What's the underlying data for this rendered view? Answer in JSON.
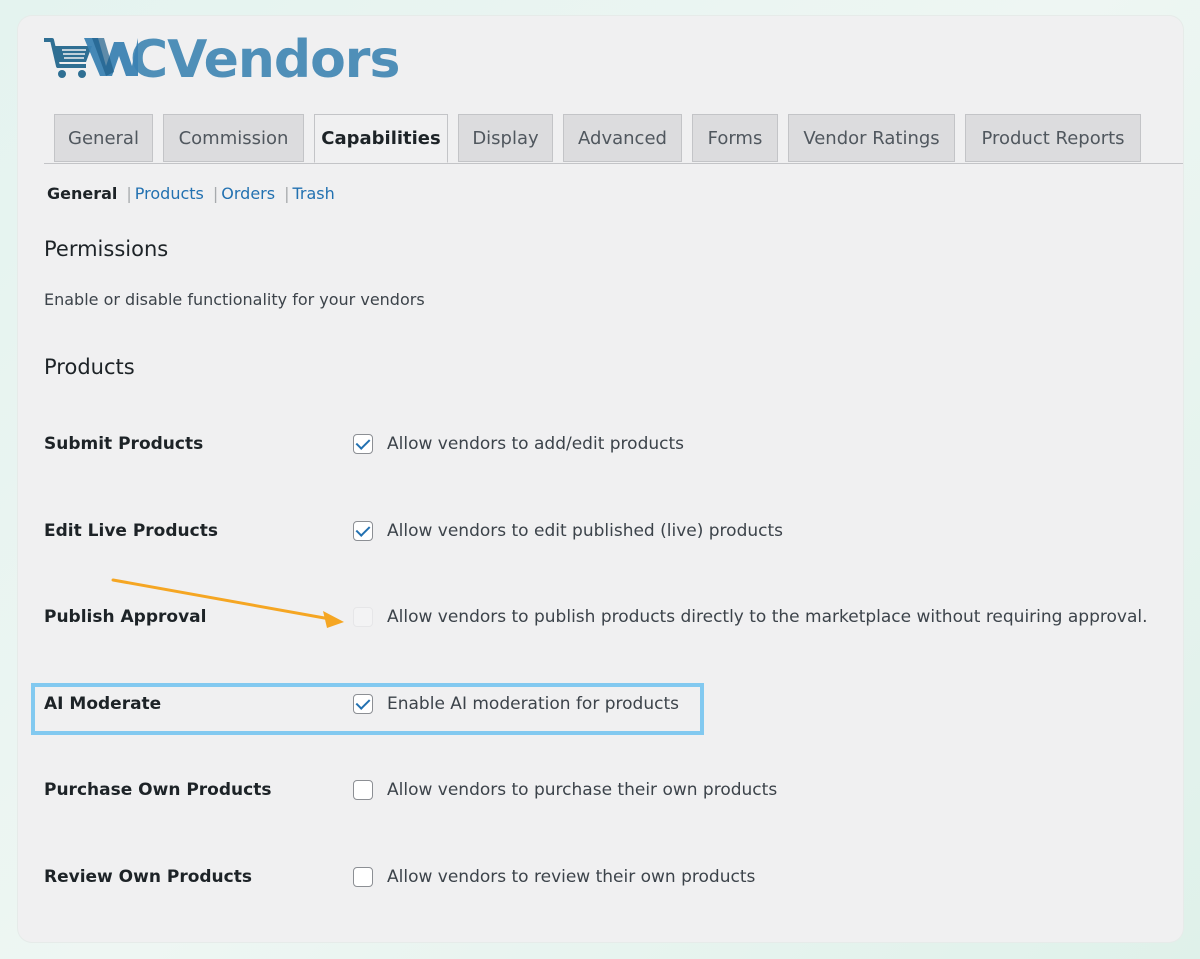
{
  "logo": {
    "text": "WCVendors",
    "mark": "cart-icon"
  },
  "tabs": [
    {
      "label": "General",
      "active": false
    },
    {
      "label": "Commission",
      "active": false
    },
    {
      "label": "Capabilities",
      "active": true
    },
    {
      "label": "Display",
      "active": false
    },
    {
      "label": "Advanced",
      "active": false
    },
    {
      "label": "Forms",
      "active": false
    },
    {
      "label": "Vendor Ratings",
      "active": false
    },
    {
      "label": "Product Reports",
      "active": false
    }
  ],
  "subnav": {
    "current": "General",
    "links": [
      "Products",
      "Orders",
      "Trash"
    ],
    "separator": "|"
  },
  "permissions": {
    "title": "Permissions",
    "description": "Enable or disable functionality for your vendors"
  },
  "products": {
    "title": "Products",
    "rows": [
      {
        "label": "Submit Products",
        "text": "Allow vendors to add/edit products",
        "checked": true
      },
      {
        "label": "Edit Live Products",
        "text": "Allow vendors to edit published (live) products",
        "checked": true
      },
      {
        "label": "Publish Approval",
        "text": "Allow vendors to publish products directly to the marketplace without requiring approval.",
        "checked": false
      },
      {
        "label": "AI Moderate",
        "text": "Enable AI moderation for products",
        "checked": true
      },
      {
        "label": "Purchase Own Products",
        "text": "Allow vendors to purchase their own products",
        "checked": false
      },
      {
        "label": "Review Own Products",
        "text": "Allow vendors to review their own products",
        "checked": false
      }
    ]
  },
  "colors": {
    "brand": "#4f8fb8",
    "link": "#2271b1",
    "highlight": "#82c9f0",
    "arrow": "#f5a623"
  }
}
